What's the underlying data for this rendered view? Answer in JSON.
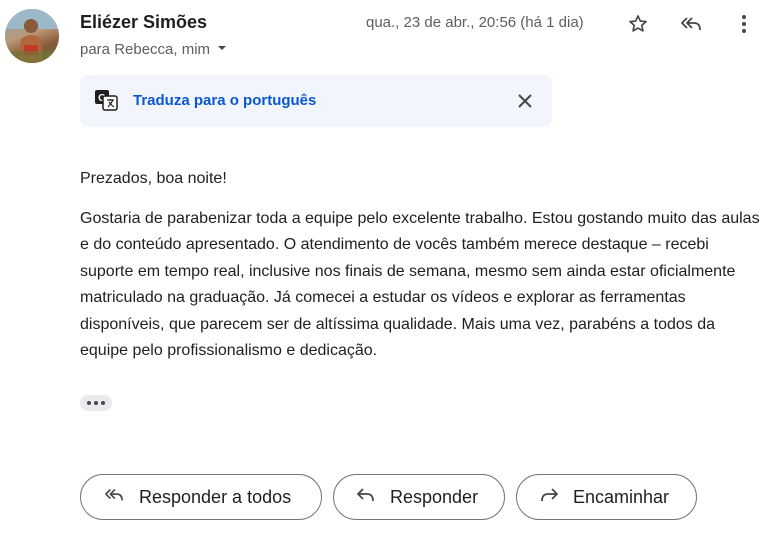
{
  "header": {
    "sender_name": "Eliézer Simões",
    "recipients": "para Rebecca, mim",
    "date": "qua., 23 de abr., 20:56 (há 1 dia)",
    "icons": [
      "avatar",
      "star-icon",
      "reply-all-icon",
      "more-vert-icon",
      "chevron-down-icon"
    ]
  },
  "translate": {
    "link_label": "Traduza para o português",
    "icons": [
      "translate-icon",
      "close-icon"
    ]
  },
  "message": {
    "greeting": "Prezados, boa noite!",
    "body": "Gostaria de parabenizar toda a equipe pelo excelente trabalho. Estou gostando muito das aulas e do conteúdo apresentado. O atendimento de vocês também merece destaque – recebi suporte em tempo real, inclusive nos finais de semana, mesmo sem ainda estar oficialmente matriculado na graduação. Já comecei a estudar os vídeos e explorar as ferramentas disponíveis, que parecem ser de altíssima qualidade. Mais uma vez, parabéns a todos da equipe pelo profissionalismo e dedicação."
  },
  "actions": {
    "reply_all_label": "Responder a todos",
    "reply_label": "Responder",
    "forward_label": "Encaminhar"
  },
  "colors": {
    "link": "#0b57d0",
    "translate_bg": "#f2f6fc",
    "secondary_text": "#5e5e5e",
    "border": "#747775"
  }
}
